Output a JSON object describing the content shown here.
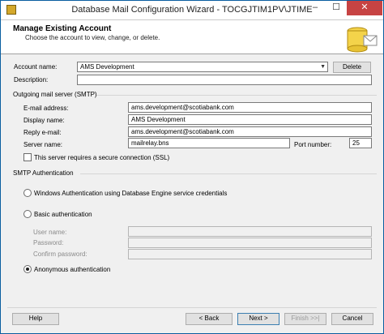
{
  "window": {
    "title": "Database Mail Configuration Wizard - TOCGJTIM1PV\\JTIME",
    "controls": {
      "minimize": "–",
      "maximize": "☐",
      "close": "✕"
    }
  },
  "header": {
    "title": "Manage Existing Account",
    "subtitle": "Choose the account to view, change, or delete."
  },
  "account": {
    "name_label": "Account name:",
    "name_value": "AMS Development",
    "delete_label": "Delete",
    "description_label": "Description:",
    "description_value": ""
  },
  "smtp": {
    "group_label": "Outgoing mail server (SMTP)",
    "email_label": "E-mail address:",
    "email_value": "ams.development@scotiabank.com",
    "display_label": "Display name:",
    "display_value": "AMS Development",
    "reply_label": "Reply e-mail:",
    "reply_value": "ams.development@scotiabank.com",
    "server_label": "Server name:",
    "server_value": "mailrelay.bns",
    "port_label": "Port number:",
    "port_value": "25",
    "ssl_label": "This server requires a secure connection (SSL)"
  },
  "auth": {
    "group_label": "SMTP Authentication",
    "windows_label": "Windows Authentication using Database Engine service credentials",
    "basic_label": "Basic authentication",
    "username_label": "User name:",
    "password_label": "Password:",
    "confirm_label": "Confirm password:",
    "anonymous_label": "Anonymous authentication",
    "selected": "anonymous"
  },
  "footer": {
    "help": "Help",
    "back": "< Back",
    "next": "Next >",
    "finish": "Finish >>|",
    "cancel": "Cancel"
  },
  "colors": {
    "window_border": "#0a5ea0",
    "close_button": "#c74343",
    "header_bg": "#ffffff",
    "body_bg": "#f0f0f0"
  }
}
